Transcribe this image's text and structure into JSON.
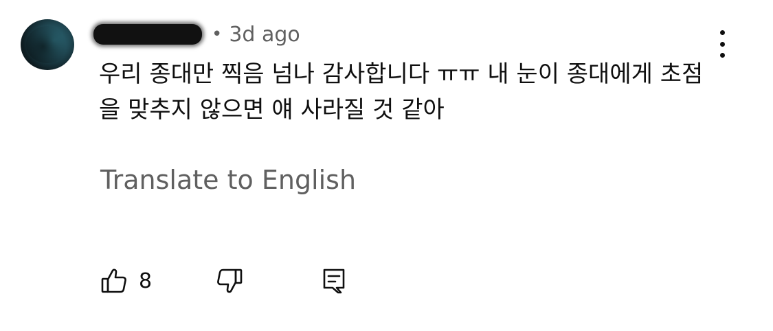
{
  "comment": {
    "author_name": "",
    "separator": "•",
    "timestamp": "3d ago",
    "text": "우리 종대만 찍음 넘나 감사합니다 ㅠㅠ 내 눈이 종대에게 초점을 맞추지 않으면 얘 사라질 것 같아",
    "translate_label": "Translate to English",
    "like_count": "8"
  },
  "icons": {
    "menu": "more-vertical-icon",
    "like": "thumbs-up-icon",
    "dislike": "thumbs-down-icon",
    "reply": "reply-comment-icon"
  },
  "colors": {
    "text_primary": "#0f0f0f",
    "text_secondary": "#606060",
    "background": "#ffffff"
  }
}
